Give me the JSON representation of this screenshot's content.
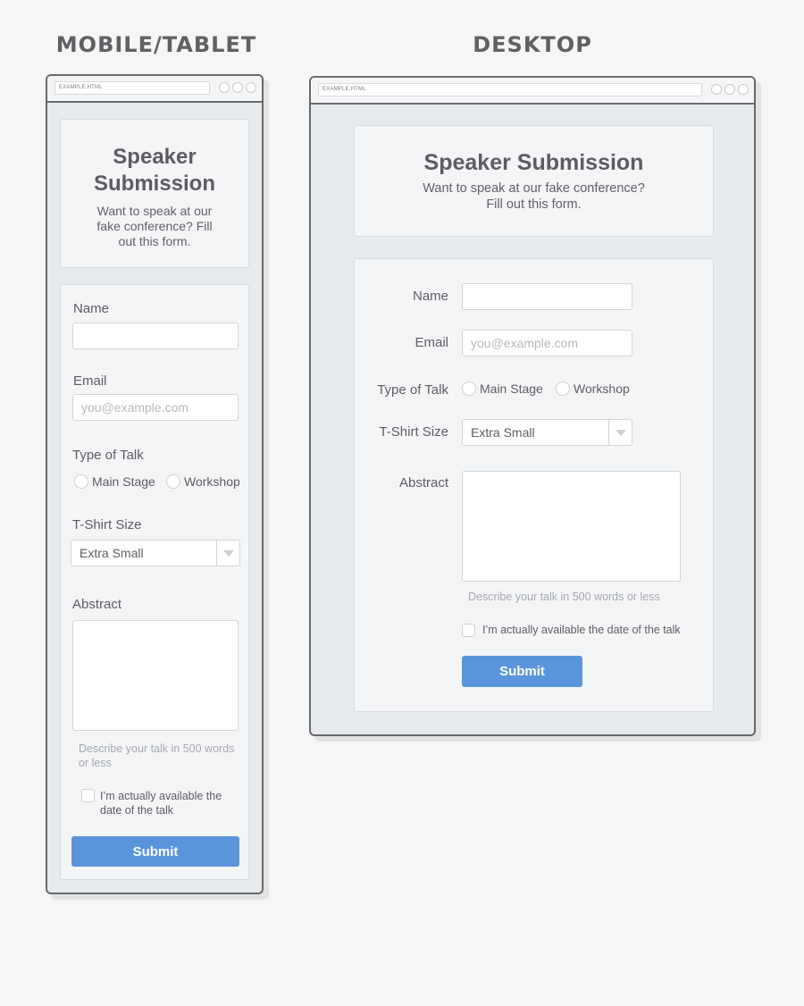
{
  "headings": {
    "mobile": "MOBILE/TABLET",
    "desktop": "DESKTOP"
  },
  "browser": {
    "url": "EXAMPLE.HTML"
  },
  "form": {
    "title": "Speaker Submission",
    "subtitle": "Want to speak at our fake conference? Fill out this form.",
    "name_label": "Name",
    "name_value": "",
    "email_label": "Email",
    "email_placeholder": "you@example.com",
    "talk_type_label": "Type of Talk",
    "talk_options": [
      "Main Stage",
      "Workshop"
    ],
    "tshirt_label": "T-Shirt Size",
    "tshirt_selected": "Extra Small",
    "abstract_label": "Abstract",
    "abstract_hint": "Describe your talk in 500 words or less",
    "availability_label": "I’m actually available the date of the talk",
    "availability_checked": false,
    "submit_label": "Submit"
  },
  "colors": {
    "accent": "#5a95dc",
    "background": "#f6f6f6",
    "window_frame": "#67696c"
  }
}
